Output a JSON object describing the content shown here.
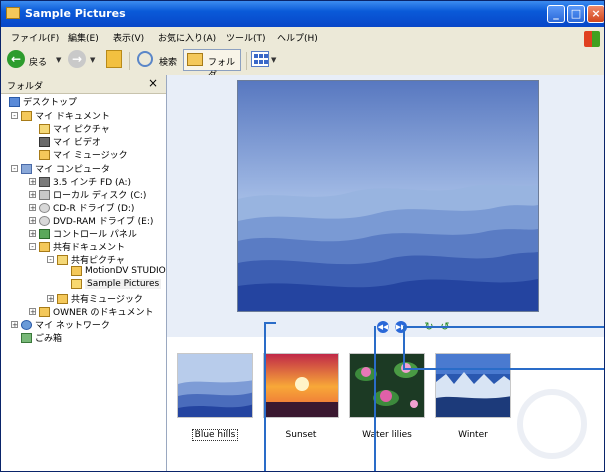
{
  "window": {
    "title": "Sample Pictures",
    "controls": {
      "minimize": "_",
      "maximize": "□",
      "close": "×"
    }
  },
  "menubar": {
    "items": [
      "ファイル(F)",
      "編集(E)",
      "表示(V)",
      "お気に入り(A)",
      "ツール(T)",
      "ヘルプ(H)"
    ]
  },
  "toolbar": {
    "back_label": "戻る",
    "search_label": "検索",
    "folders_label": "フォルダ"
  },
  "folder_panel": {
    "title": "フォルダ",
    "close_glyph": "×",
    "tree": [
      {
        "label": "デスクトップ",
        "icon": "desktop-icon"
      },
      {
        "label": "マイ ドキュメント",
        "icon": "my-documents-icon"
      },
      {
        "label": "マイ ピクチャ",
        "icon": "my-pictures-icon"
      },
      {
        "label": "マイ ビデオ",
        "icon": "my-videos-icon"
      },
      {
        "label": "マイ ミュージック",
        "icon": "my-music-icon"
      },
      {
        "label": "マイ コンピュータ",
        "icon": "my-computer-icon"
      },
      {
        "label": "3.5 インチ FD (A:)",
        "icon": "floppy-drive-icon"
      },
      {
        "label": "ローカル ディスク (C:)",
        "icon": "hard-disk-icon"
      },
      {
        "label": "CD-R ドライブ (D:)",
        "icon": "cd-drive-icon"
      },
      {
        "label": "DVD-RAM ドライブ (E:)",
        "icon": "dvd-drive-icon"
      },
      {
        "label": "コントロール パネル",
        "icon": "control-panel-icon"
      },
      {
        "label": "共有ドキュメント",
        "icon": "folder-icon"
      },
      {
        "label": "共有ピクチャ",
        "icon": "shared-pictures-icon"
      },
      {
        "label": "MotionDV STUDIO",
        "icon": "folder-icon"
      },
      {
        "label": "Sample Pictures",
        "icon": "folder-open-icon"
      },
      {
        "label": "共有ミュージック",
        "icon": "shared-music-icon"
      },
      {
        "label": "OWNER のドキュメント",
        "icon": "folder-icon"
      },
      {
        "label": "マイ ネットワーク",
        "icon": "network-icon"
      },
      {
        "label": "ごみ箱",
        "icon": "recycle-bin-icon"
      }
    ]
  },
  "filmstrip": {
    "items": [
      {
        "label": "Blue hills",
        "selected": true
      },
      {
        "label": "Sunset",
        "selected": false
      },
      {
        "label": "Water lilies",
        "selected": false
      },
      {
        "label": "Winter",
        "selected": false
      }
    ],
    "controls": [
      "previous-image-icon",
      "next-image-icon",
      "rotate-clockwise-icon",
      "rotate-counterclockwise-icon"
    ]
  },
  "colors": {
    "titlebar": "#0a5ad8",
    "callout": "#2a6cc8",
    "hills_light": "#9ab8e4",
    "hills_dark": "#1a3c9c"
  }
}
